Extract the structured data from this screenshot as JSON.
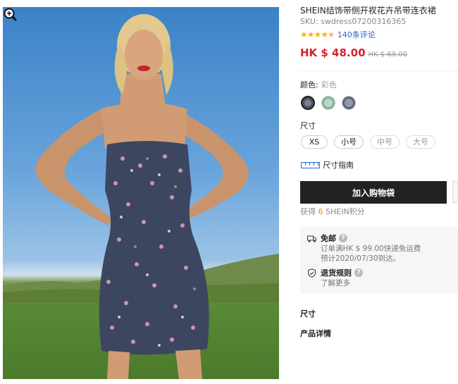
{
  "product": {
    "title": "SHEIN结饰带侧开衩花卉吊带连衣裙",
    "sku": "SKU: swdress07200316365",
    "rating_stars": 4.5,
    "reviews": "140条评论",
    "price": "HK $ 48.00",
    "original_price": "HK $ 69.00"
  },
  "color": {
    "label": "颜色:",
    "value": "彩色",
    "swatches": [
      {
        "name": "dark-floral",
        "color": "#4a4f5c",
        "inner": "#7a8190",
        "selected": true
      },
      {
        "name": "green-floral",
        "color": "#7fb39a",
        "inner": "#b6d8c4",
        "selected": false
      },
      {
        "name": "navy-floral",
        "color": "#5d6478",
        "inner": "#9098aa",
        "selected": false
      }
    ]
  },
  "size": {
    "label": "尺寸",
    "options": [
      {
        "label": "XS",
        "available": true
      },
      {
        "label": "小号",
        "available": true
      },
      {
        "label": "中号",
        "available": false
      },
      {
        "label": "大号",
        "available": false
      }
    ],
    "guide": "尺寸指南"
  },
  "cart": {
    "button": "加入购物袋"
  },
  "points": {
    "prefix": "获得",
    "value": "6",
    "suffix": "SHEIN积分"
  },
  "shipping": {
    "free_title": "免邮",
    "free_line1": "订单满HK $ 99.00快递免运费",
    "free_line2": "预计2020/07/30到达。",
    "return_title": "退货规则",
    "return_link": "了解更多"
  },
  "sections": {
    "size": "尺寸",
    "details": "产品详情"
  },
  "colors": {
    "price": "#d5232b",
    "star": "#f4b21b",
    "link": "#2a64c8",
    "button": "#222222"
  }
}
